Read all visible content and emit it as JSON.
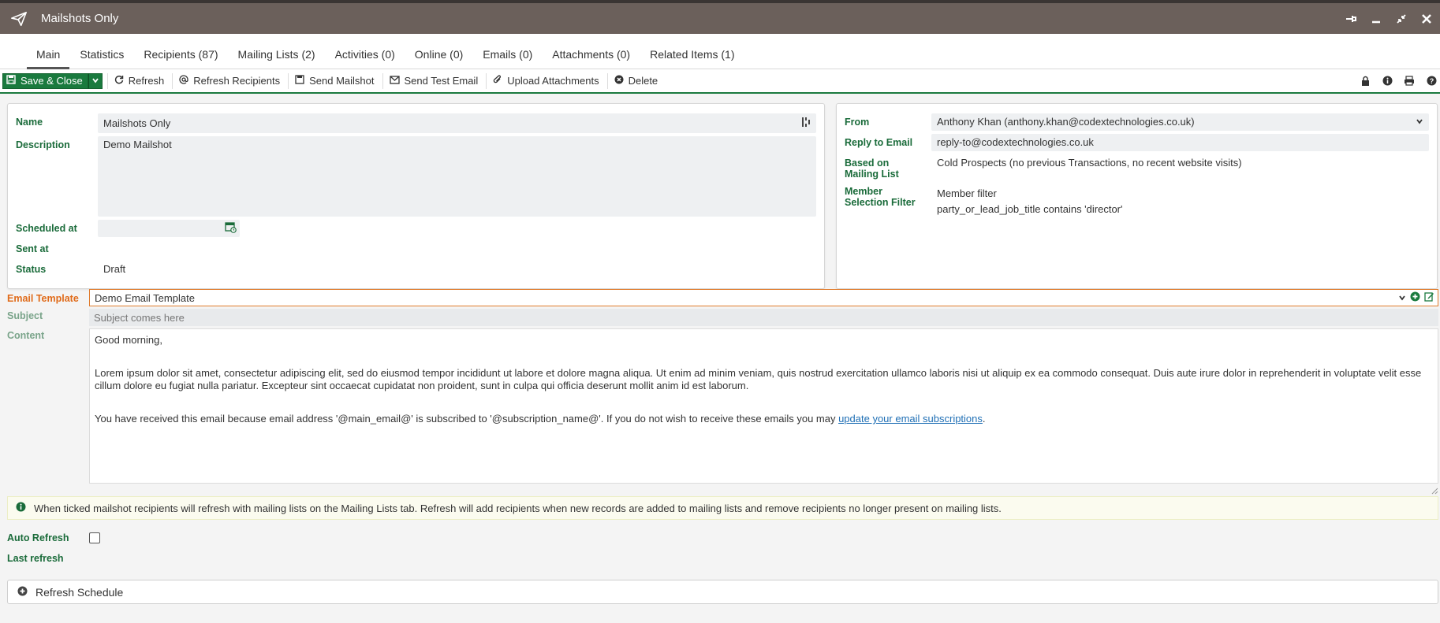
{
  "window": {
    "title": "Mailshots Only"
  },
  "tabs": [
    {
      "label": "Main"
    },
    {
      "label": "Statistics"
    },
    {
      "label": "Recipients (87)"
    },
    {
      "label": "Mailing Lists (2)"
    },
    {
      "label": "Activities (0)"
    },
    {
      "label": "Online (0)"
    },
    {
      "label": "Emails (0)"
    },
    {
      "label": "Attachments (0)"
    },
    {
      "label": "Related Items (1)"
    }
  ],
  "toolbar": {
    "save_close": "Save & Close",
    "refresh": "Refresh",
    "refresh_recipients": "Refresh Recipients",
    "send_mailshot": "Send Mailshot",
    "send_test_email": "Send Test Email",
    "upload_attachments": "Upload Attachments",
    "delete": "Delete"
  },
  "left_panel": {
    "name_label": "Name",
    "name_value": "Mailshots Only",
    "description_label": "Description",
    "description_value": "Demo Mailshot",
    "scheduled_label": "Scheduled at",
    "scheduled_value": "",
    "sent_label": "Sent at",
    "sent_value": "",
    "status_label": "Status",
    "status_value": "Draft"
  },
  "right_panel": {
    "from_label": "From",
    "from_value": "Anthony Khan (anthony.khan@codextechnologies.co.uk)",
    "reply_label": "Reply to Email",
    "reply_value": "reply-to@codextechnologies.co.uk",
    "based_label_1": "Based on",
    "based_label_2": "Mailing List",
    "based_value": "Cold Prospects (no previous Transactions, no recent website visits)",
    "member_label_1": "Member",
    "member_label_2": "Selection Filter",
    "member_value_1": "Member filter",
    "member_value_2": "party_or_lead_job_title contains 'director'"
  },
  "template": {
    "label": "Email Template",
    "value": "Demo Email Template",
    "subject_label": "Subject",
    "subject_placeholder": "Subject comes here",
    "content_label": "Content",
    "greeting": "Good morning,",
    "body": "Lorem ipsum dolor sit amet, consectetur adipiscing elit, sed do eiusmod tempor incididunt ut labore et dolore magna aliqua. Ut enim ad minim veniam, quis nostrud exercitation ullamco laboris nisi ut aliquip ex ea commodo consequat. Duis aute irure dolor in reprehenderit in voluptate velit esse cillum dolore eu fugiat nulla pariatur. Excepteur sint occaecat cupidatat non proident, sunt in culpa qui officia deserunt mollit anim id est laborum.",
    "footer_text": "You have received this email because email address '@main_email@' is subscribed to '@subscription_name@'. If you do not wish to receive these emails you may ",
    "footer_link": "update your email subscriptions",
    "footer_end": "."
  },
  "info": {
    "text": "When ticked mailshot recipients will refresh with mailing lists on the Mailing Lists tab. Refresh will add recipients when new records are added to mailing lists and remove recipients no longer present on mailing lists."
  },
  "auto_refresh": {
    "label": "Auto Refresh",
    "checked": false
  },
  "last_refresh": {
    "label": "Last refresh"
  },
  "refresh_schedule": {
    "label": "Refresh Schedule"
  },
  "colors": {
    "accent_green": "#1a7a3e",
    "label_green": "#1a6b3a",
    "title_bar": "#6b605b",
    "template_orange": "#e06b1a"
  },
  "icons": [
    "paper-plane-icon",
    "pin-icon",
    "minimize-icon",
    "restore-icon",
    "close-icon",
    "save-icon",
    "chevron-down-icon",
    "refresh-icon",
    "at-icon",
    "send-icon",
    "envelope-icon",
    "paperclip-icon",
    "delete-icon",
    "lock-icon",
    "info-icon",
    "print-icon",
    "help-icon",
    "calendar-icon",
    "plus-circle-icon",
    "edit-icon"
  ]
}
